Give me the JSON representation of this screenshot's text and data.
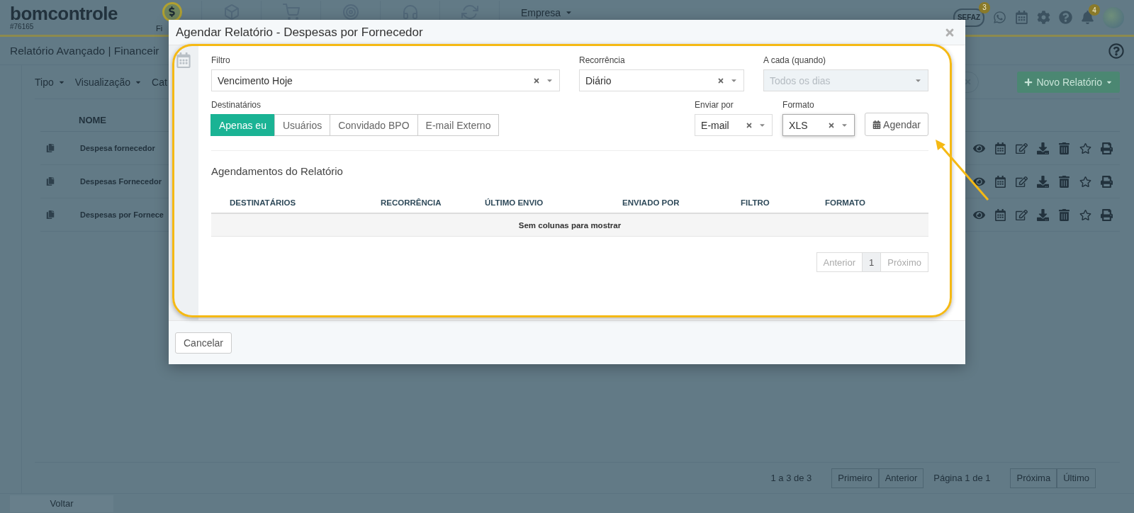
{
  "topbar": {
    "logo": "bomcontrole",
    "account": "#76165",
    "nav": [
      {
        "label": "Fi",
        "selected": true
      },
      {
        "selected": false
      },
      {
        "selected": false
      },
      {
        "selected": false
      },
      {
        "selected": false
      },
      {
        "selected": false
      }
    ],
    "company_menu": "Empresa",
    "sefaz": {
      "label": "SEFAZ",
      "badge": "3"
    },
    "notifications_badge": "4"
  },
  "page": {
    "title": "Relatório Avançado | Financeir",
    "filters": [
      "Tipo",
      "Visualização"
    ],
    "filter_cut_off": "Cat",
    "new_report_button": "Novo Relatório",
    "table": {
      "columns": [
        "NOME"
      ],
      "rows": [
        {
          "name": "Despesa fornecedor"
        },
        {
          "name": "Despesas Fornecedor"
        },
        {
          "name": "Despesas por Fornece"
        }
      ]
    },
    "pagination": {
      "summary": "1 a 3 de 3",
      "prev_buttons": [
        "Primeiro",
        "Anterior"
      ],
      "page_label": "Página 1 de 1",
      "next_buttons": [
        "Próxima",
        "Último"
      ]
    },
    "back_button": "Voltar"
  },
  "modal": {
    "title": "Agendar Relatório - Despesas por Fornecedor",
    "filter": {
      "label": "Filtro",
      "value": "Vencimento Hoje"
    },
    "recurrence": {
      "label": "Recorrência",
      "value": "Diário"
    },
    "every": {
      "label": "A cada (quando)",
      "placeholder": "Todos os dias",
      "disabled": true
    },
    "recipients": {
      "label": "Destinatários",
      "options": [
        {
          "label": "Apenas eu",
          "selected": true
        },
        {
          "label": "Usuários",
          "selected": false
        },
        {
          "label": "Convidado BPO",
          "selected": false
        },
        {
          "label": "E-mail Externo",
          "selected": false
        }
      ]
    },
    "send_by": {
      "label": "Enviar por",
      "value": "E-mail",
      "focused": false
    },
    "format": {
      "label": "Formato",
      "value": "XLS",
      "focused": true
    },
    "schedule_button": "Agendar",
    "schedules": {
      "title": "Agendamentos do Relatório",
      "columns": [
        "DESTINATÁRIOS",
        "RECORRÊNCIA",
        "ÚLTIMO ENVIO",
        "ENVIADO POR",
        "FILTRO",
        "FORMATO"
      ],
      "empty": "Sem colunas para mostrar",
      "pagination": {
        "prev": "Anterior",
        "pages": [
          {
            "label": "1",
            "selected": true
          }
        ],
        "next": "Próximo"
      }
    },
    "cancel_button": "Cancelar"
  }
}
